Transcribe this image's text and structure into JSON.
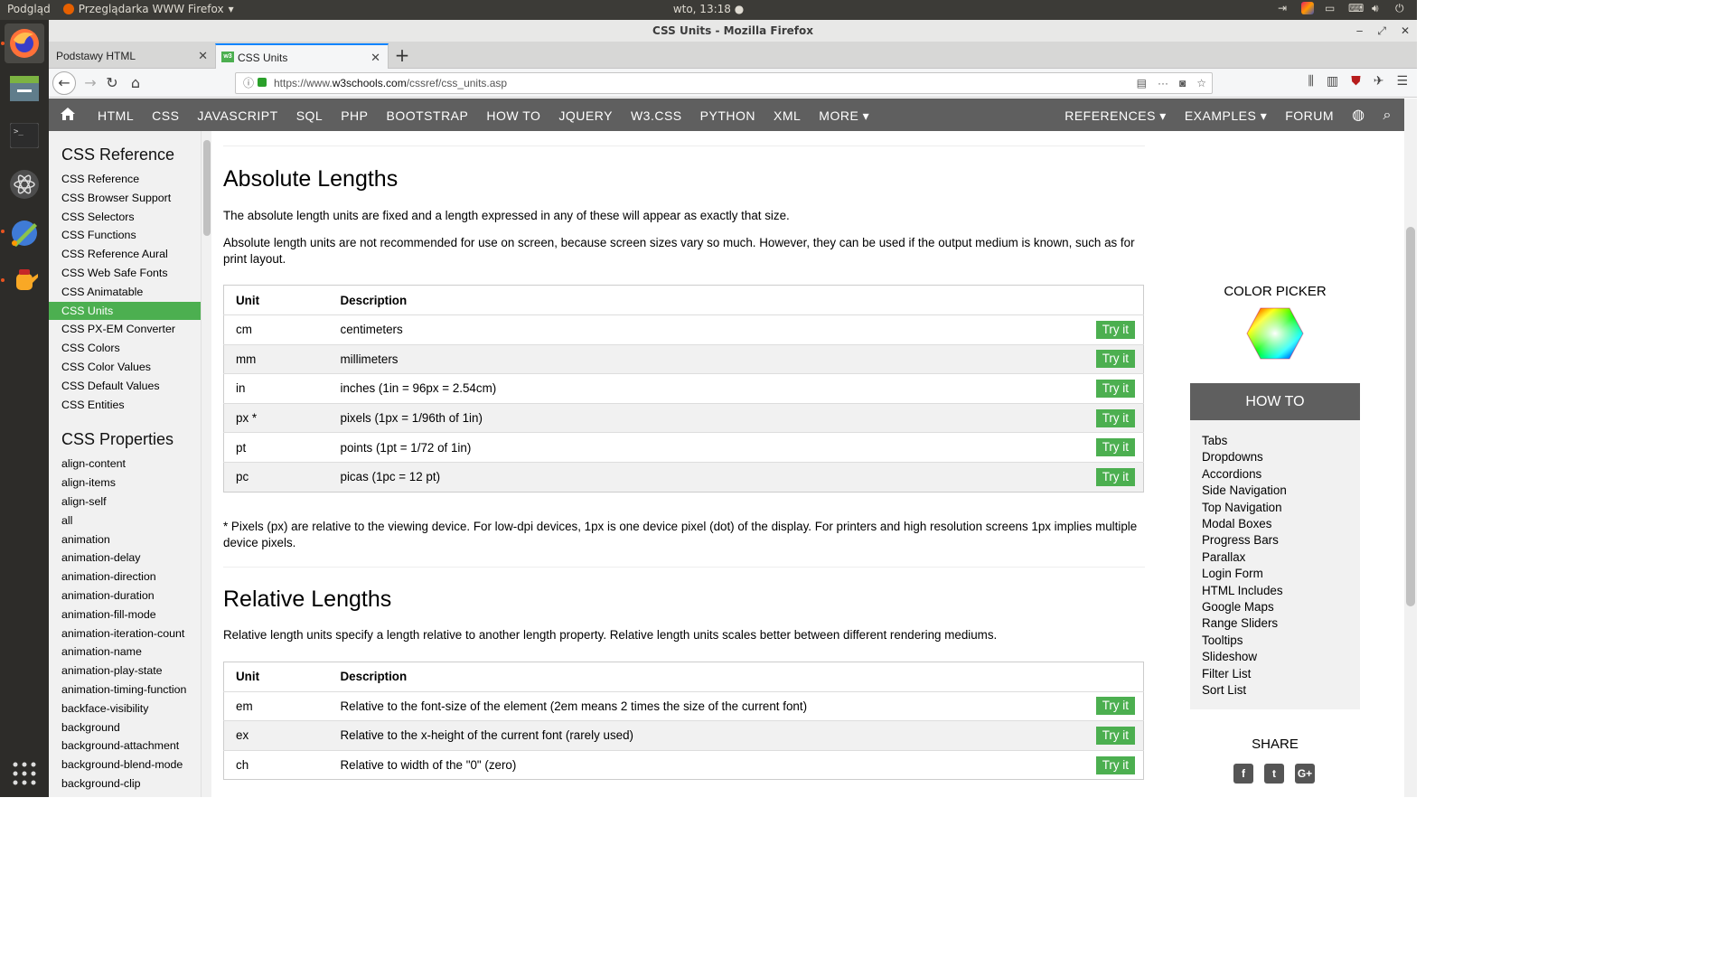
{
  "os": {
    "app_menu": "Podgląd",
    "active_app": "Przeglądarka WWW Firefox",
    "clock": "wto, 13:18"
  },
  "window": {
    "title": "CSS Units - Mozilla Firefox"
  },
  "tabs": [
    {
      "label": "Podstawy HTML"
    },
    {
      "label": "CSS Units",
      "favicon": "w3"
    }
  ],
  "url": {
    "prefix": "https://www.",
    "domain": "w3schools.com",
    "path": "/cssref/css_units.asp"
  },
  "topnav": {
    "items": [
      "HTML",
      "CSS",
      "JAVASCRIPT",
      "SQL",
      "PHP",
      "BOOTSTRAP",
      "HOW TO",
      "JQUERY",
      "W3.CSS",
      "PYTHON",
      "XML",
      "MORE ▾"
    ],
    "right_items": [
      "REFERENCES ▾",
      "EXAMPLES ▾",
      "FORUM"
    ]
  },
  "sidebar": {
    "ref_title": "CSS Reference",
    "ref_items": [
      "CSS Reference",
      "CSS Browser Support",
      "CSS Selectors",
      "CSS Functions",
      "CSS Reference Aural",
      "CSS Web Safe Fonts",
      "CSS Animatable",
      "CSS Units",
      "CSS PX-EM Converter",
      "CSS Colors",
      "CSS Color Values",
      "CSS Default Values",
      "CSS Entities"
    ],
    "active_item": "CSS Units",
    "props_title": "CSS Properties",
    "props_items": [
      "align-content",
      "align-items",
      "align-self",
      "all",
      "animation",
      "animation-delay",
      "animation-direction",
      "animation-duration",
      "animation-fill-mode",
      "animation-iteration-count",
      "animation-name",
      "animation-play-state",
      "animation-timing-function",
      "backface-visibility",
      "background",
      "background-attachment",
      "background-blend-mode",
      "background-clip"
    ]
  },
  "main": {
    "abs_title": "Absolute Lengths",
    "abs_p1": "The absolute length units are fixed and a length expressed in any of these will appear as exactly that size.",
    "abs_p2": "Absolute length units are not recommended for use on screen, because screen sizes vary so much. However, they can be used if the output medium is known, such as for print layout.",
    "col_unit": "Unit",
    "col_desc": "Description",
    "try_label": "Try it",
    "abs_rows": [
      {
        "unit": "cm",
        "desc": "centimeters"
      },
      {
        "unit": "mm",
        "desc": "millimeters"
      },
      {
        "unit": "in",
        "desc": "inches (1in = 96px = 2.54cm)"
      },
      {
        "unit": "px *",
        "desc": "pixels (1px = 1/96th of 1in)"
      },
      {
        "unit": "pt",
        "desc": "points (1pt = 1/72 of 1in)"
      },
      {
        "unit": "pc",
        "desc": "picas (1pc = 12 pt)"
      }
    ],
    "px_note": "* Pixels (px) are relative to the viewing device. For low-dpi devices, 1px is one device pixel (dot) of the display. For printers and high resolution screens 1px implies multiple device pixels.",
    "rel_title": "Relative Lengths",
    "rel_p1": "Relative length units specify a length relative to another length property. Relative length units scales better between different rendering mediums.",
    "rel_rows": [
      {
        "unit": "em",
        "desc": "Relative to the font-size of the element (2em means 2 times the size of the current font)"
      },
      {
        "unit": "ex",
        "desc": "Relative to the x-height of the current font (rarely used)"
      },
      {
        "unit": "ch",
        "desc": "Relative to width of the \"0\" (zero)"
      }
    ]
  },
  "right": {
    "color_picker": "COLOR PICKER",
    "howto_title": "HOW TO",
    "howto_items": [
      "Tabs",
      "Dropdowns",
      "Accordions",
      "Side Navigation",
      "Top Navigation",
      "Modal Boxes",
      "Progress Bars",
      "Parallax",
      "Login Form",
      "HTML Includes",
      "Google Maps",
      "Range Sliders",
      "Tooltips",
      "Slideshow",
      "Filter List",
      "Sort List"
    ],
    "share_title": "SHARE"
  },
  "colors": {
    "accent_green": "#4caf50",
    "nav_gray": "#5f5f5f",
    "sidebar_bg": "#f1f1f1",
    "firefox_blue": "#0a84ff",
    "ubuntu_orange": "#e95420"
  }
}
